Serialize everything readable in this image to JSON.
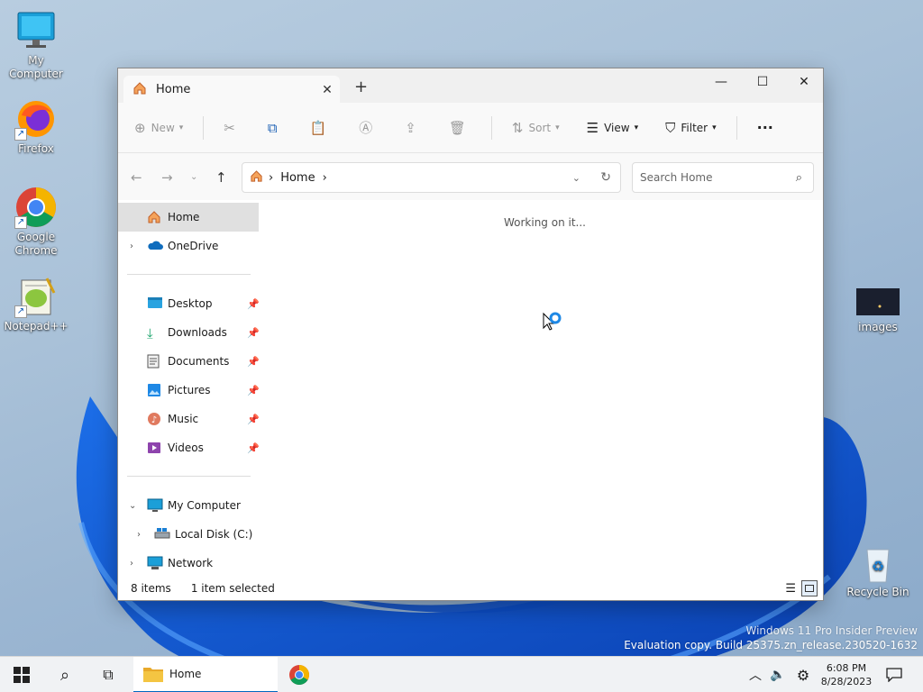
{
  "desktop": {
    "icons": [
      {
        "label": "My Computer"
      },
      {
        "label": "Firefox"
      },
      {
        "label": "Google Chrome"
      },
      {
        "label": "Notepad++"
      },
      {
        "label": "images"
      },
      {
        "label": "Recycle Bin"
      }
    ],
    "watermark": {
      "line1": "Windows 11 Pro Insider Preview",
      "line2": "Evaluation copy. Build 25375.zn_release.230520-1632"
    }
  },
  "explorer": {
    "tab_title": "Home",
    "toolbar": {
      "new_label": "New",
      "sort_label": "Sort",
      "view_label": "View",
      "filter_label": "Filter",
      "more_label": "···"
    },
    "address": {
      "crumb": "Home",
      "search_placeholder": "Search Home"
    },
    "sidebar": {
      "items": [
        {
          "label": "Home"
        },
        {
          "label": "OneDrive"
        },
        {
          "label": "Desktop"
        },
        {
          "label": "Downloads"
        },
        {
          "label": "Documents"
        },
        {
          "label": "Pictures"
        },
        {
          "label": "Music"
        },
        {
          "label": "Videos"
        },
        {
          "label": "My Computer"
        },
        {
          "label": "Local Disk (C:)"
        },
        {
          "label": "Network"
        }
      ]
    },
    "content": {
      "status_message": "Working on it..."
    },
    "statusbar": {
      "item_count": "8 items",
      "selection": "1 item selected"
    }
  },
  "taskbar": {
    "active_app_label": "Home",
    "time": "6:08 PM",
    "date": "8/28/2023"
  },
  "colors": {
    "accent": "#0067c0",
    "folder": "#f4c542"
  }
}
